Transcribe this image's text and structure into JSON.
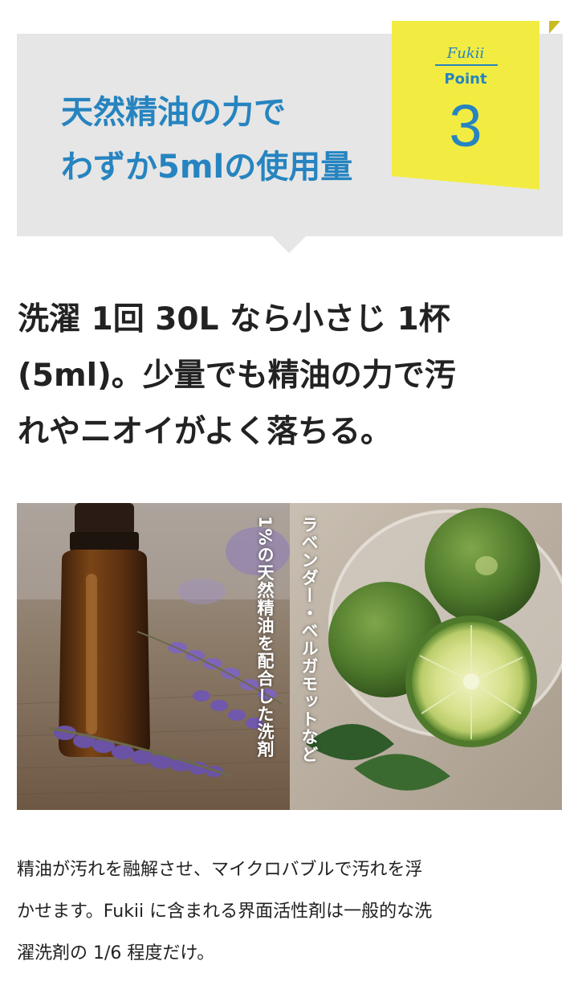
{
  "header": {
    "headline_lines": [
      "天然精油の力で",
      "わずか5mlの使用量"
    ],
    "badge": {
      "brand": "Fukii",
      "point_label": "Point",
      "number": "3"
    }
  },
  "subhead_lines": [
    "洗濯 1回 30L なら小さじ 1杯",
    "(5ml)。少量でも精油の力で汚",
    "れやニオイがよく落ちる。"
  ],
  "photo": {
    "overlay_text_1": "1%の天然精油を配合した洗剤",
    "overlay_text_2": "ラベンダー・ベルガモットなど"
  },
  "body_lines": [
    "精油が汚れを融解させ、マイクロバブルで汚れを浮",
    "かせます。Fukii に含まれる界面活性剤は一般的な洗",
    "濯洗剤の 1/6 程度だけ。"
  ],
  "colors": {
    "accent_blue": "#2684c0",
    "badge_yellow": "#f2ec42",
    "header_gray": "#e6e6e6",
    "text_dark": "#222222"
  }
}
